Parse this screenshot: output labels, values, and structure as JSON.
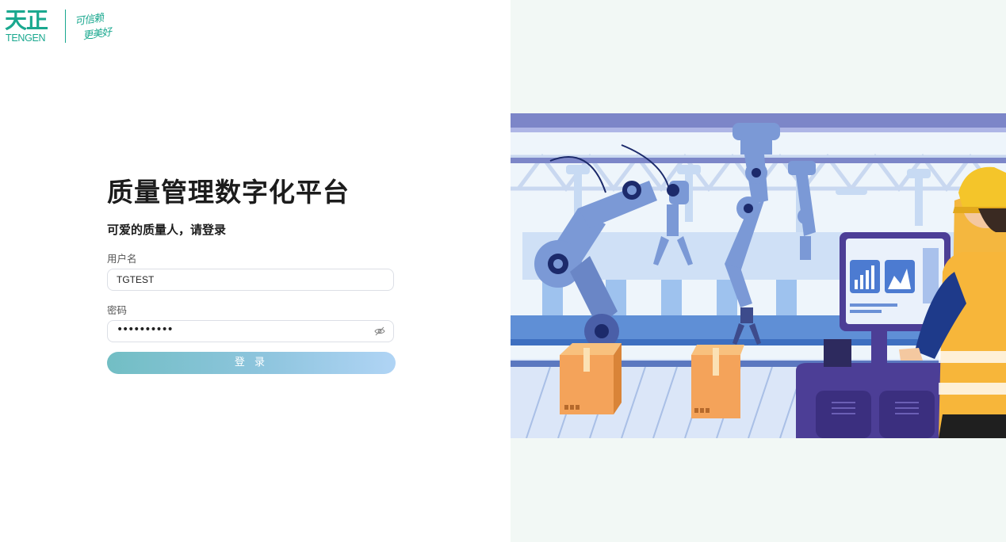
{
  "brand": {
    "name_cn": "天正",
    "name_en": "TENGEN",
    "slogan_line1": "可信赖",
    "slogan_line2": "更美好",
    "color": "#1aa88f"
  },
  "login": {
    "title": "质量管理数字化平台",
    "subtitle": "可爱的质量人，请登录",
    "username_label": "用户名",
    "username_value": "TGTEST",
    "password_label": "密码",
    "password_masked": "••••••••••",
    "password_toggle_icon": "eye-off-icon",
    "submit_label": "登 录"
  },
  "illustration": {
    "subject": "factory-robot-arms-with-worker-at-monitor",
    "background": "#f2f8f5"
  }
}
